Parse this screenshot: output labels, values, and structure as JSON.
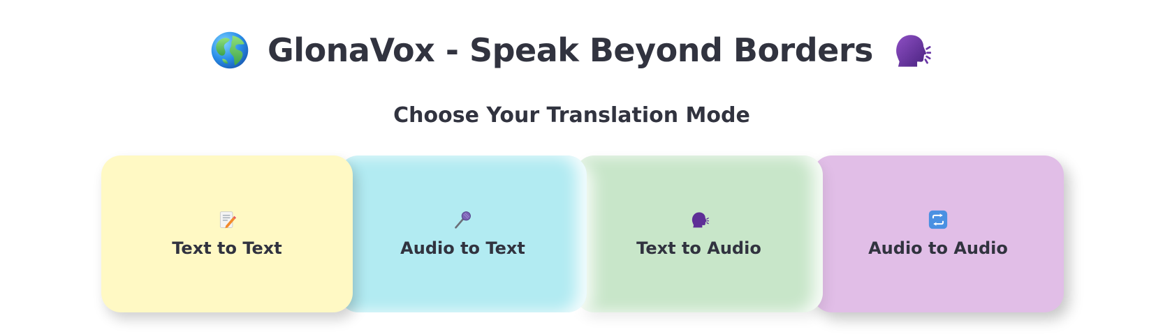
{
  "header": {
    "title_text": "GlonaVox - Speak Beyond Borders",
    "left_icon": "globe-icon",
    "right_icon": "speaking-head-icon"
  },
  "section": {
    "subtitle": "Choose Your Translation Mode"
  },
  "modes": [
    {
      "label": "Text to Text",
      "icon": "memo-icon",
      "color": "#fff9c4"
    },
    {
      "label": "Audio to Text",
      "icon": "microphone-icon",
      "color": "#b2ebf2"
    },
    {
      "label": "Text to Audio",
      "icon": "speaking-head-icon",
      "color": "#c8e6c9"
    },
    {
      "label": "Audio to Audio",
      "icon": "repeat-icon",
      "color": "#e1bee7"
    }
  ],
  "colors": {
    "text": "#31333f",
    "background": "#ffffff"
  }
}
